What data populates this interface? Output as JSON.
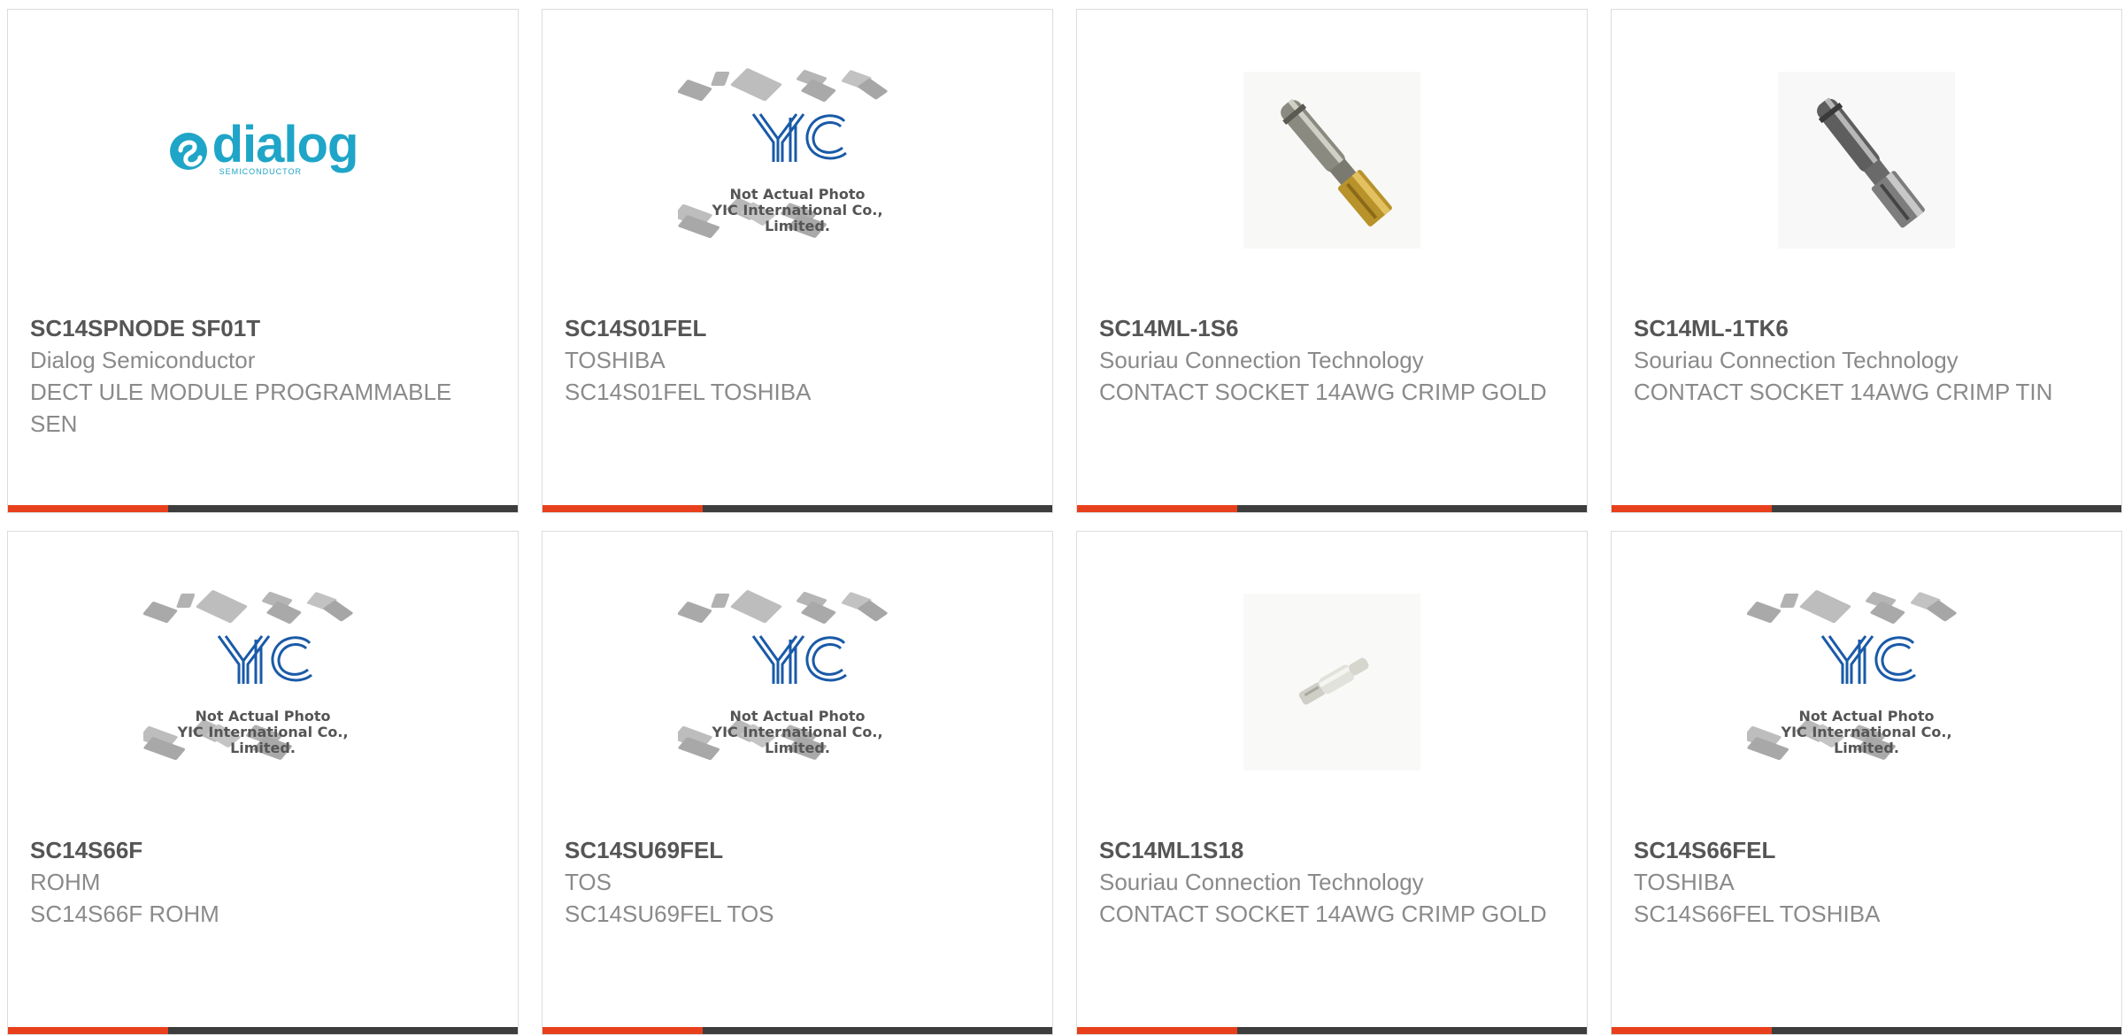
{
  "colors": {
    "accent": "#e8401c",
    "bar_dark": "#3d3d3d",
    "card_border": "#dcdcdc",
    "title_text": "#555555",
    "meta_text": "#8a8a8a",
    "dialog_brand": "#1fa5c8",
    "yic_blue": "#1a5aa8"
  },
  "placeholder": {
    "line1": "Not Actual Photo",
    "line2": "YIC International Co., Limited.",
    "logo": "YIC"
  },
  "cards": [
    {
      "image": "dialog-logo",
      "logo_text": "dialog",
      "logo_sub": "SEMICONDUCTOR",
      "part_number": "SC14SPNODE SF01T",
      "manufacturer": "Dialog Semiconductor",
      "description": "DECT ULE MODULE PROGRAMMABLE SEN"
    },
    {
      "image": "yic-placeholder",
      "part_number": "SC14S01FEL",
      "manufacturer": "TOSHIBA",
      "description": "SC14S01FEL TOSHIBA"
    },
    {
      "image": "contact-gold-photo",
      "part_number": "SC14ML-1S6",
      "manufacturer": "Souriau Connection Technology",
      "description": "CONTACT SOCKET 14AWG CRIMP GOLD"
    },
    {
      "image": "contact-tin-photo",
      "part_number": "SC14ML-1TK6",
      "manufacturer": "Souriau Connection Technology",
      "description": "CONTACT SOCKET 14AWG CRIMP TIN"
    },
    {
      "image": "yic-placeholder",
      "part_number": "SC14S66F",
      "manufacturer": "ROHM",
      "description": "SC14S66F ROHM"
    },
    {
      "image": "yic-placeholder",
      "part_number": "SC14SU69FEL",
      "manufacturer": "TOS",
      "description": "SC14SU69FEL TOS"
    },
    {
      "image": "contact-small-photo",
      "part_number": "SC14ML1S18",
      "manufacturer": "Souriau Connection Technology",
      "description": "CONTACT SOCKET 14AWG CRIMP GOLD"
    },
    {
      "image": "yic-placeholder",
      "part_number": "SC14S66FEL",
      "manufacturer": "TOSHIBA",
      "description": "SC14S66FEL TOSHIBA"
    }
  ]
}
